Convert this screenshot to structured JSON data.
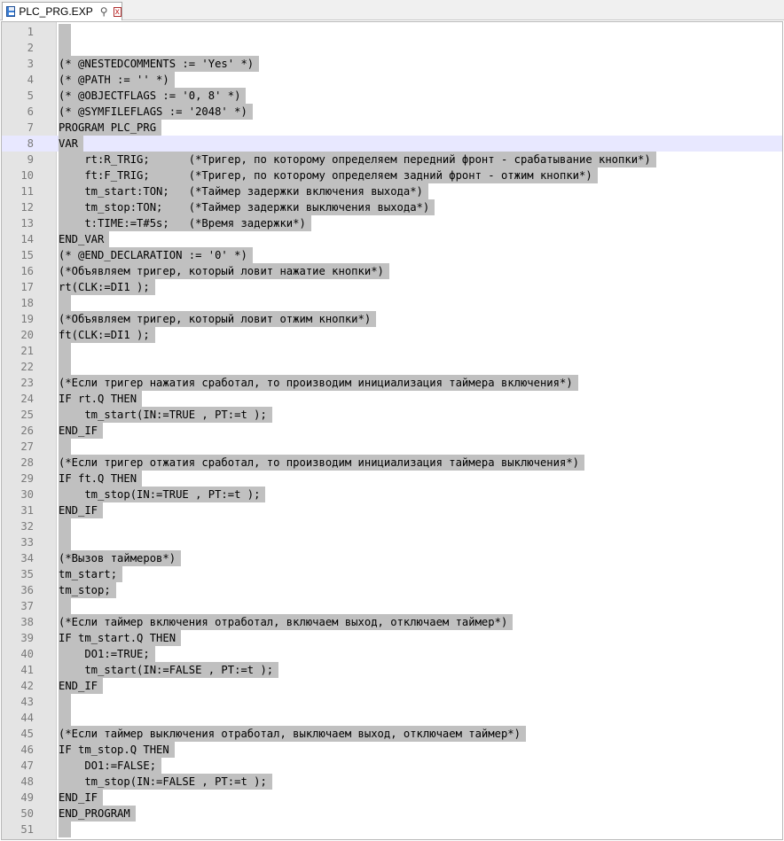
{
  "tab": {
    "title": "PLC_PRG.EXP",
    "pin": "⚲",
    "close": "x"
  },
  "editor": {
    "current_line": 8,
    "lines": [
      "",
      "",
      "(* @NESTEDCOMMENTS := 'Yes' *)",
      "(* @PATH := '' *)",
      "(* @OBJECTFLAGS := '0, 8' *)",
      "(* @SYMFILEFLAGS := '2048' *)",
      "PROGRAM PLC_PRG",
      "VAR",
      "    rt:R_TRIG;      (*Тригер, по которому определяем передний фронт - срабатывание кнопки*)",
      "    ft:F_TRIG;      (*Тригер, по которому определяем задний фронт - отжим кнопки*)",
      "    tm_start:TON;   (*Таймер задержки включения выхода*)",
      "    tm_stop:TON;    (*Таймер задержки выключения выхода*)",
      "    t:TIME:=T#5s;   (*Время задержки*)",
      "END_VAR",
      "(* @END_DECLARATION := '0' *)",
      "(*Объявляем тригер, который ловит нажатие кнопки*)",
      "rt(CLK:=DI1 );",
      "",
      "(*Объявляем тригер, который ловит отжим кнопки*)",
      "ft(CLK:=DI1 );",
      "",
      "",
      "(*Если тригер нажатия сработал, то производим инициализация таймера включения*)",
      "IF rt.Q THEN",
      "    tm_start(IN:=TRUE , PT:=t );",
      "END_IF",
      "",
      "(*Если тригер отжатия сработал, то производим инициализация таймера выключения*)",
      "IF ft.Q THEN",
      "    tm_stop(IN:=TRUE , PT:=t );",
      "END_IF",
      "",
      "",
      "(*Вызов таймеров*)",
      "tm_start;",
      "tm_stop;",
      "",
      "(*Если таймер включения отработал, включаем выход, отключаем таймер*)",
      "IF tm_start.Q THEN",
      "    DO1:=TRUE;",
      "    tm_start(IN:=FALSE , PT:=t );",
      "END_IF",
      "",
      "",
      "(*Если таймер выключения отработал, выключаем выход, отключаем таймер*)",
      "IF tm_stop.Q THEN",
      "    DO1:=FALSE;",
      "    tm_stop(IN:=FALSE , PT:=t );",
      "END_IF",
      "END_PROGRAM",
      ""
    ]
  }
}
